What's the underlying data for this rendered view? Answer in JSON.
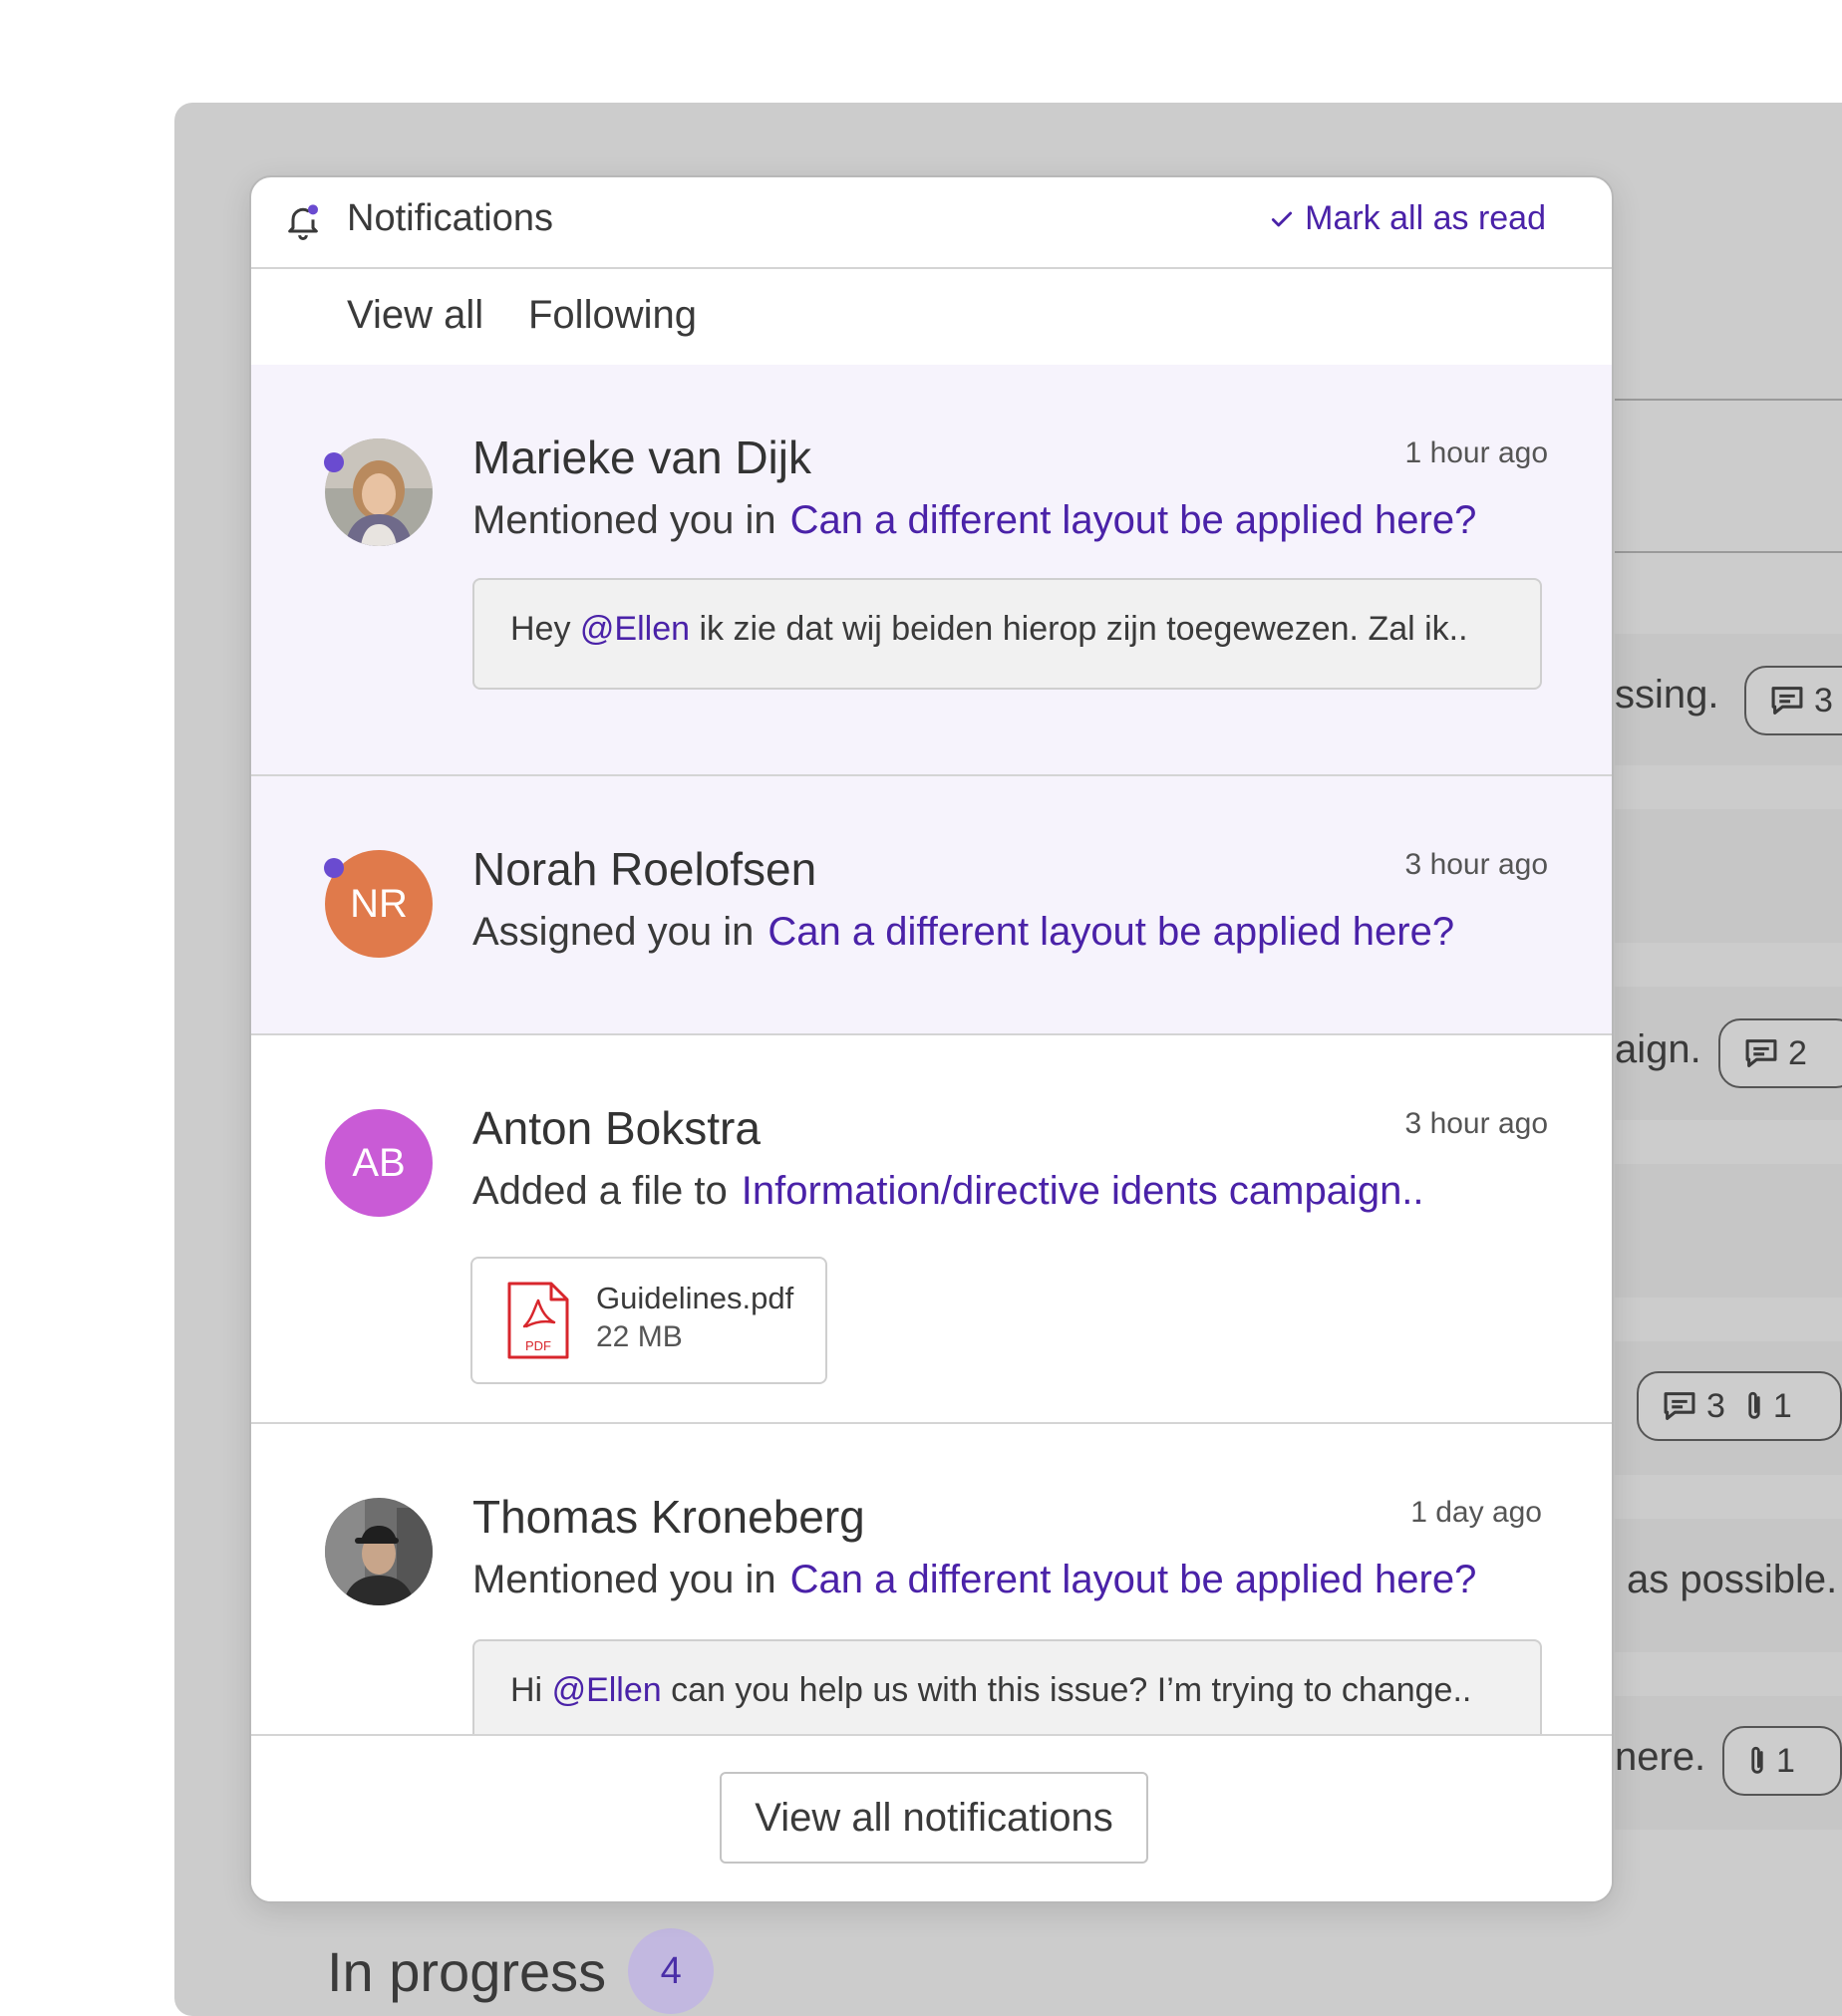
{
  "background": {
    "rows": [
      {
        "text": "ssing.",
        "pill": {
          "comments": "3",
          "attachments": ""
        }
      },
      {
        "text": "aign.",
        "pill": {
          "comments": "2",
          "attachments": ""
        }
      },
      {
        "text": "",
        "pill": {
          "comments": "3",
          "attachments": "1"
        }
      },
      {
        "text": "as possible.",
        "pill": null
      },
      {
        "text": "nere.",
        "pill": {
          "comments": "",
          "attachments": "1"
        }
      }
    ],
    "section_heading": "In progress",
    "section_count": "4"
  },
  "notifications_panel": {
    "title": "Notifications",
    "mark_all_read": "Mark all as read",
    "tabs": [
      "View all",
      "Following"
    ],
    "items": [
      {
        "name": "Marieke van Dijk",
        "time": "1 hour ago",
        "action": "Mentioned you in",
        "link": "Can a different layout be applied here?",
        "unread": true,
        "avatar_type": "photo",
        "quote": {
          "before": "Hey",
          "mention": "@Ellen",
          "after": "ik zie dat wij beiden hierop zijn toegewezen. Zal ik.."
        }
      },
      {
        "name": "Norah Roelofsen",
        "time": "3 hour ago",
        "action": "Assigned you in",
        "link": "Can a different layout be applied here?",
        "unread": true,
        "avatar_initials": "NR",
        "avatar_color": "#e07a4b"
      },
      {
        "name": "Anton Bokstra",
        "time": "3 hour ago",
        "action": "Added a file to",
        "link": "Information/directive idents campaign..",
        "unread": false,
        "avatar_initials": "AB",
        "avatar_color": "#c95bd6",
        "file": {
          "name": "Guidelines.pdf",
          "size": "22 MB",
          "icon": "pdf-icon",
          "icon_label": "PDF"
        }
      },
      {
        "name": "Thomas Kroneberg",
        "time": "1 day ago",
        "action": "Mentioned you in",
        "link": "Can a different layout be applied here?",
        "unread": false,
        "avatar_type": "photo",
        "quote": {
          "before": "Hi",
          "mention": "@Ellen",
          "after": "can you help us with this issue? I’m trying to change.."
        }
      }
    ],
    "footer_button": "View all notifications"
  },
  "colors": {
    "accent": "#4a22a8",
    "unread_bg": "#f6f3fc",
    "unread_dot": "#6a4bd0",
    "backdrop": "#cccccc"
  }
}
